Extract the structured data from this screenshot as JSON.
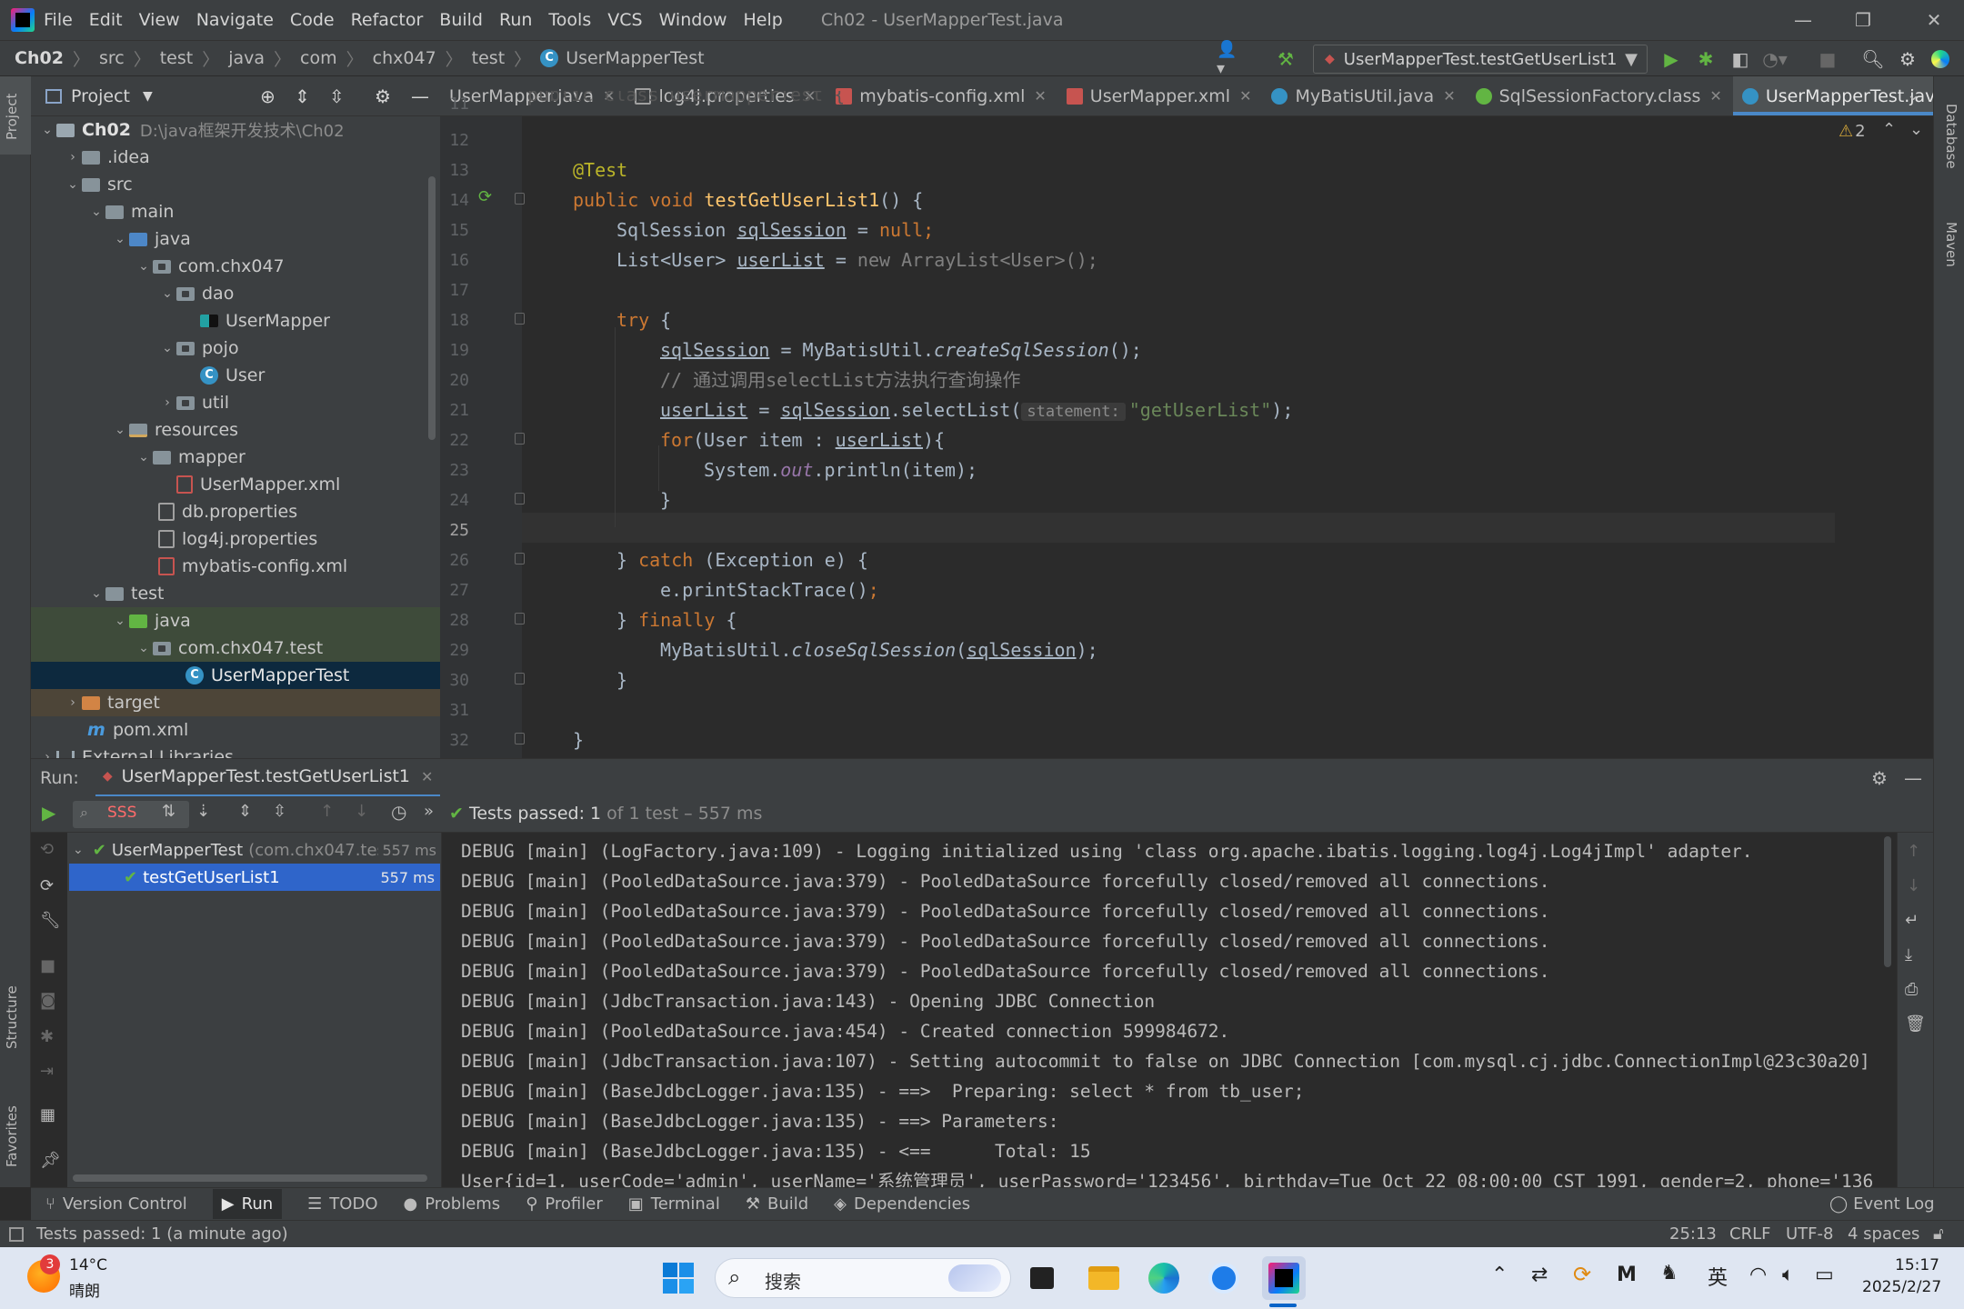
{
  "window": {
    "title": "Ch02 - UserMapperTest.java"
  },
  "menu": [
    "File",
    "Edit",
    "View",
    "Navigate",
    "Code",
    "Refactor",
    "Build",
    "Run",
    "Tools",
    "VCS",
    "Window",
    "Help"
  ],
  "breadcrumb": [
    "Ch02",
    "src",
    "test",
    "java",
    "com",
    "chx047",
    "test",
    "UserMapperTest"
  ],
  "run_config": "UserMapperTest.testGetUserList1",
  "project": {
    "title": "Project",
    "tree": [
      {
        "label": "Ch02",
        "extra": "D:\\java框架开发技术\\Ch02"
      },
      {
        "label": ".idea"
      },
      {
        "label": "src"
      },
      {
        "label": "main"
      },
      {
        "label": "java"
      },
      {
        "label": "com.chx047"
      },
      {
        "label": "dao"
      },
      {
        "label": "UserMapper"
      },
      {
        "label": "pojo"
      },
      {
        "label": "User"
      },
      {
        "label": "util"
      },
      {
        "label": "resources"
      },
      {
        "label": "mapper"
      },
      {
        "label": "UserMapper.xml"
      },
      {
        "label": "db.properties"
      },
      {
        "label": "log4j.properties"
      },
      {
        "label": "mybatis-config.xml"
      },
      {
        "label": "test"
      },
      {
        "label": "java"
      },
      {
        "label": "com.chx047.test"
      },
      {
        "label": "UserMapperTest"
      },
      {
        "label": "target"
      },
      {
        "label": "pom.xml"
      },
      {
        "label": "External Libraries"
      }
    ]
  },
  "tabs": [
    "UserMapper.java",
    "log4j.properties",
    "mybatis-config.xml",
    "UserMapper.xml",
    "MyBatisUtil.java",
    "SqlSessionFactory.class",
    "UserMapperTest.java"
  ],
  "editor": {
    "warnings": "2",
    "line_numbers": [
      "11",
      "12",
      "13",
      "14",
      "15",
      "16",
      "17",
      "18",
      "19",
      "20",
      "21",
      "22",
      "23",
      "24",
      "25",
      "26",
      "27",
      "28",
      "29",
      "30",
      "31",
      "32"
    ],
    "code": {
      "l11": "public class UserMapperTest {",
      "l13": "@Test",
      "l14a": "public void ",
      "l14b": "testGetUserList1",
      "l14c": "() {",
      "l15a": "SqlSession ",
      "l15b": "sqlSession",
      "l15c": " = ",
      "l15d": "null",
      "l15e": ";",
      "l16a": "List<User> ",
      "l16b": "userList",
      "l16c": " = ",
      "l16d": "new ArrayList<User>();",
      "l18a": "try",
      "l18b": " {",
      "l19a": "sqlSession",
      "l19b": " = MyBatisUtil.",
      "l19c": "createSqlSession",
      "l19d": "();",
      "l20": "// 通过调用selectList方法执行查询操作",
      "l21a": "userList",
      "l21b": " = ",
      "l21c": "sqlSession",
      "l21d": ".selectList(",
      "l21hint": "statement:",
      "l21e": "\"getUserList\"",
      "l21f": ");",
      "l22a": "for",
      "l22b": "(User item : ",
      "l22c": "userList",
      "l22d": "){",
      "l23a": "System.",
      "l23b": "out",
      "l23c": ".println(item);",
      "l24": "}",
      "l26a": "} ",
      "l26b": "catch",
      "l26c": " (Exception e) {",
      "l27a": "e.printStackTrace()",
      "l27b": ";",
      "l28a": "} ",
      "l28b": "finally",
      "l28c": " {",
      "l29a": "MyBatisUtil.",
      "l29b": "closeSqlSession",
      "l29c": "(",
      "l29d": "sqlSession",
      "l29e": ");",
      "l30": "}",
      "l32": "}"
    }
  },
  "run": {
    "label": "Run:",
    "tab": "UserMapperTest.testGetUserList1",
    "filter": "SSS",
    "status_prefix": "Tests passed: ",
    "status_count": "1",
    "status_suffix": " of 1 test – 557 ms",
    "tree": [
      {
        "label": "UserMapperTest",
        "detail": "(com.chx047.tes",
        "time": "557 ms"
      },
      {
        "label": "testGetUserList1",
        "time": "557 ms"
      }
    ],
    "console": [
      "DEBUG [main] (LogFactory.java:109) - Logging initialized using 'class org.apache.ibatis.logging.log4j.Log4jImpl' adapter.",
      "DEBUG [main] (PooledDataSource.java:379) - PooledDataSource forcefully closed/removed all connections.",
      "DEBUG [main] (PooledDataSource.java:379) - PooledDataSource forcefully closed/removed all connections.",
      "DEBUG [main] (PooledDataSource.java:379) - PooledDataSource forcefully closed/removed all connections.",
      "DEBUG [main] (PooledDataSource.java:379) - PooledDataSource forcefully closed/removed all connections.",
      "DEBUG [main] (JdbcTransaction.java:143) - Opening JDBC Connection",
      "DEBUG [main] (PooledDataSource.java:454) - Created connection 599984672.",
      "DEBUG [main] (JdbcTransaction.java:107) - Setting autocommit to false on JDBC Connection [com.mysql.cj.jdbc.ConnectionImpl@23c30a20]",
      "DEBUG [main] (BaseJdbcLogger.java:135) - ==>  Preparing: select * from tb_user;",
      "DEBUG [main] (BaseJdbcLogger.java:135) - ==> Parameters: ",
      "DEBUG [main] (BaseJdbcLogger.java:135) - <==      Total: 15",
      "User{id=1, userCode='admin', userName='系统管理员', userPassword='123456', birthday=Tue Oct 22 08:00:00 CST 1991, gender=2, phone='136"
    ]
  },
  "toolwindows": [
    "Version Control",
    "Run",
    "TODO",
    "Problems",
    "Profiler",
    "Terminal",
    "Build",
    "Dependencies"
  ],
  "event_log": "Event Log",
  "side_labels": {
    "project": "Project",
    "structure": "Structure",
    "favorites": "Favorites",
    "database": "Database",
    "maven": "Maven"
  },
  "status": {
    "message": "Tests passed: 1 (a minute ago)",
    "position": "25:13",
    "line_sep": "CRLF",
    "encoding": "UTF-8",
    "indent": "4 spaces"
  },
  "taskbar": {
    "weather_temp": "14°C",
    "weather_desc": "晴朗",
    "weather_badge": "3",
    "search_placeholder": "搜索",
    "ime": "英",
    "time": "15:17",
    "date": "2025/2/27"
  },
  "colors": {
    "accent": "#4a88c7",
    "editor_bg": "#2b2b2b",
    "panel_bg": "#3c3f41",
    "pass_green": "#62b543"
  }
}
